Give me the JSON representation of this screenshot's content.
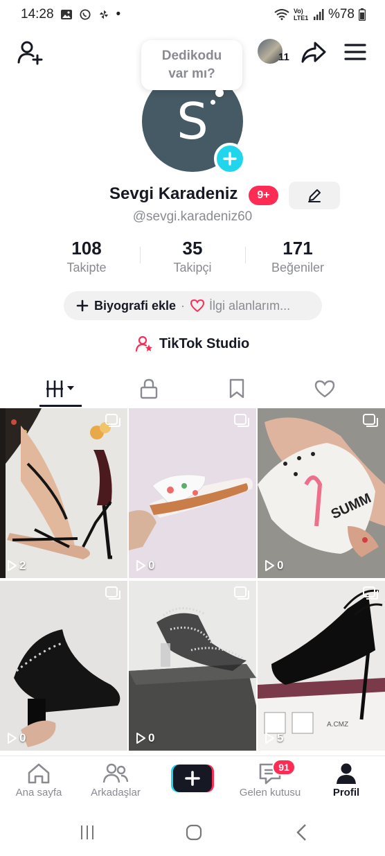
{
  "status_bar": {
    "time": "14:28",
    "dot": "•",
    "network": "Vo) LTE1",
    "battery": "%78",
    "icons": [
      "gallery-icon",
      "whatsapp-icon",
      "pinwheel-icon",
      "wifi-icon",
      "signal-icon",
      "battery-icon"
    ]
  },
  "header": {
    "viewer_count": "11",
    "icons": [
      "add-friend-icon",
      "share-icon",
      "menu-icon"
    ]
  },
  "bubble": {
    "line1": "Dedikodu",
    "line2": "var mı?"
  },
  "profile": {
    "avatar_letter": "S",
    "avatar_color": "#455a64",
    "name": "Sevgi Karadeniz",
    "badge": "9+",
    "username": "@sevgi.karadeniz60"
  },
  "stats": [
    {
      "value": "108",
      "label": "Takipte"
    },
    {
      "value": "35",
      "label": "Takipçi"
    },
    {
      "value": "171",
      "label": "Beğeniler"
    }
  ],
  "bio": {
    "add_label": "Biyografi ekle",
    "separator": "·",
    "interests_label": "İlgi alanlarım..."
  },
  "studio_label": "TikTok Studio",
  "tabs": [
    "videos-grid-icon",
    "lock-icon",
    "bookmark-icon",
    "heart-icon"
  ],
  "videos": [
    {
      "views": "2"
    },
    {
      "views": "0"
    },
    {
      "views": "0"
    },
    {
      "views": "0"
    },
    {
      "views": "0"
    },
    {
      "views": "5"
    }
  ],
  "bottom_nav": {
    "home": "Ana sayfa",
    "friends": "Arkadaşlar",
    "inbox": "Gelen kutusu",
    "inbox_badge": "91",
    "profile": "Profil"
  },
  "colors": {
    "accent_red": "#fe2c55",
    "accent_cyan": "#20d5ec",
    "text_primary": "#161823",
    "text_secondary": "#8a8b91"
  }
}
